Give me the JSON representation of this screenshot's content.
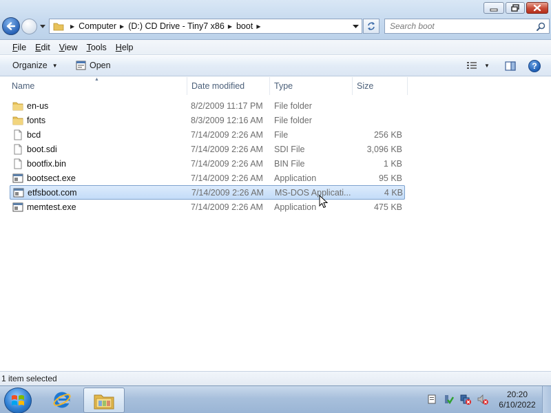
{
  "window": {
    "breadcrumb": [
      "Computer",
      "(D:) CD Drive - Tiny7 x86",
      "boot"
    ],
    "search_placeholder": "Search boot"
  },
  "menubar": {
    "items": [
      "File",
      "Edit",
      "View",
      "Tools",
      "Help"
    ]
  },
  "commandbar": {
    "organize_label": "Organize",
    "open_label": "Open"
  },
  "columns": {
    "name": "Name",
    "date": "Date modified",
    "type": "Type",
    "size": "Size"
  },
  "files": [
    {
      "name": "en-us",
      "date": "8/2/2009 11:17 PM",
      "type": "File folder",
      "size": "",
      "icon": "folder-icon"
    },
    {
      "name": "fonts",
      "date": "8/3/2009 12:16 AM",
      "type": "File folder",
      "size": "",
      "icon": "folder-icon"
    },
    {
      "name": "bcd",
      "date": "7/14/2009 2:26 AM",
      "type": "File",
      "size": "256 KB",
      "icon": "file-icon"
    },
    {
      "name": "boot.sdi",
      "date": "7/14/2009 2:26 AM",
      "type": "SDI File",
      "size": "3,096 KB",
      "icon": "file-icon"
    },
    {
      "name": "bootfix.bin",
      "date": "7/14/2009 2:26 AM",
      "type": "BIN File",
      "size": "1 KB",
      "icon": "file-icon"
    },
    {
      "name": "bootsect.exe",
      "date": "7/14/2009 2:26 AM",
      "type": "Application",
      "size": "95 KB",
      "icon": "application-icon"
    },
    {
      "name": "etfsboot.com",
      "date": "7/14/2009 2:26 AM",
      "type": "MS-DOS Applicati...",
      "size": "4 KB",
      "icon": "application-icon",
      "selected": true
    },
    {
      "name": "memtest.exe",
      "date": "7/14/2009 2:26 AM",
      "type": "Application",
      "size": "475 KB",
      "icon": "application-icon"
    }
  ],
  "statusbar": {
    "text": "1 item selected"
  },
  "taskbar": {
    "time": "20:20",
    "date": "6/10/2022"
  },
  "colors": {
    "selection": "#cde3f9",
    "selection_border": "#7da2ce",
    "secondary_text": "#6d6d6d",
    "column_header_text": "#4c607a"
  }
}
